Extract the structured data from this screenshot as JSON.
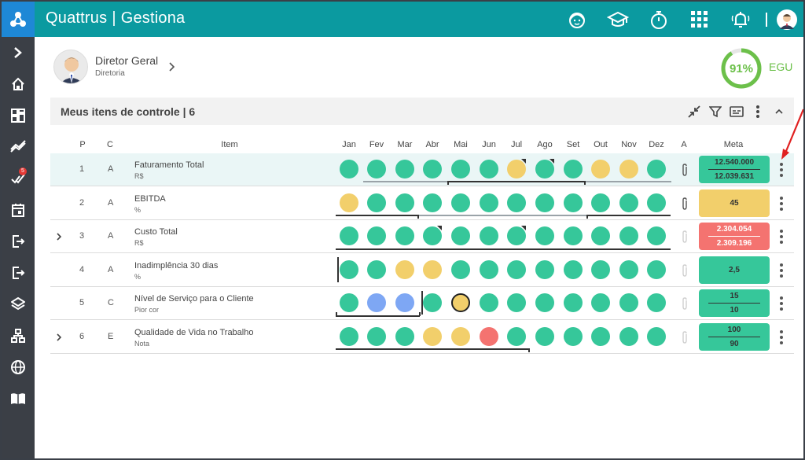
{
  "app": {
    "brand": "Quattrus",
    "separator": "|",
    "module": "Gestiona"
  },
  "topbar_icons": [
    "support-agent-icon",
    "graduation-cap-icon",
    "stopwatch-icon",
    "apps-grid-icon",
    "bell-icon",
    "user-avatar"
  ],
  "sidebar": [
    "chevron-right-icon",
    "home-icon",
    "dashboard-icon",
    "trend-icon",
    "tasks-icon",
    "calendar-icon",
    "exit-icon",
    "exit-icon",
    "layers-icon",
    "hierarchy-icon",
    "globe-icon",
    "book-icon"
  ],
  "sidebar_badge": "5",
  "profile": {
    "name": "Diretor Geral",
    "subtitle": "Diretoria"
  },
  "score": {
    "value": "91%",
    "fraction": 0.91,
    "label": "EGU",
    "color": "#6cc04a"
  },
  "panel": {
    "title": "Meus itens de controle | 6"
  },
  "columns": {
    "p": "P",
    "c": "C",
    "item": "Item",
    "months": [
      "Jan",
      "Fev",
      "Mar",
      "Abr",
      "Mai",
      "Jun",
      "Jul",
      "Ago",
      "Set",
      "Out",
      "Nov",
      "Dez"
    ],
    "a": "A",
    "meta": "Meta"
  },
  "rows": [
    {
      "p": "1",
      "c": "A",
      "name": "Faturamento Total",
      "unit": "R$",
      "expandable": false,
      "statuses": [
        "g",
        "g",
        "g",
        "g",
        "g",
        "g",
        "y",
        "g",
        "g",
        "y",
        "y",
        "g"
      ],
      "flags": [
        6,
        7
      ],
      "clip": "active",
      "meta_top": "12.540.000",
      "meta_bottom": "12.039.631",
      "meta_color": "#36c79a"
    },
    {
      "p": "2",
      "c": "A",
      "name": "EBITDA",
      "unit": "%",
      "expandable": false,
      "statuses": [
        "y",
        "g",
        "g",
        "g",
        "g",
        "g",
        "g",
        "g",
        "g",
        "g",
        "g",
        "g"
      ],
      "flags": [],
      "clip": "active",
      "meta_top": "",
      "meta_bottom": "45",
      "meta_color": "#f2cf6b"
    },
    {
      "p": "3",
      "c": "A",
      "name": "Custo Total",
      "unit": "R$",
      "expandable": true,
      "statuses": [
        "g",
        "g",
        "g",
        "g",
        "g",
        "g",
        "g",
        "g",
        "g",
        "g",
        "g",
        "g"
      ],
      "flags": [
        3,
        6
      ],
      "clip": "faded",
      "meta_top": "2.304.054",
      "meta_bottom": "2.309.196",
      "meta_color": "#f47370"
    },
    {
      "p": "4",
      "c": "A",
      "name": "Inadimplência 30 dias",
      "unit": "%",
      "expandable": false,
      "statuses": [
        "g",
        "g",
        "y",
        "y",
        "g",
        "g",
        "g",
        "g",
        "g",
        "g",
        "g",
        "g"
      ],
      "flags": [],
      "clip": "faded",
      "meta_top": "2,5",
      "meta_bottom": "",
      "meta_color": "#36c79a"
    },
    {
      "p": "5",
      "c": "C",
      "name": "Nível de Serviço para o Cliente",
      "unit": "Pior cor",
      "expandable": false,
      "statuses": [
        "g",
        "b",
        "b",
        "g",
        "y",
        "g",
        "g",
        "g",
        "g",
        "g",
        "g",
        "g"
      ],
      "flags": [],
      "clip": "faded",
      "meta_top": "15",
      "meta_bottom": "10",
      "meta_color": "#36c79a"
    },
    {
      "p": "6",
      "c": "E",
      "name": "Qualidade de Vida no Trabalho",
      "unit": "Nota",
      "expandable": true,
      "statuses": [
        "g",
        "g",
        "g",
        "y",
        "y",
        "r",
        "g",
        "g",
        "g",
        "g",
        "g",
        "g"
      ],
      "flags": [],
      "clip": "faded",
      "meta_top": "100",
      "meta_bottom": "90",
      "meta_color": "#36c79a"
    }
  ],
  "status_colors": {
    "g": "#36c79a",
    "y": "#f2cf6b",
    "b": "#7ea7f4",
    "r": "#f47370"
  }
}
